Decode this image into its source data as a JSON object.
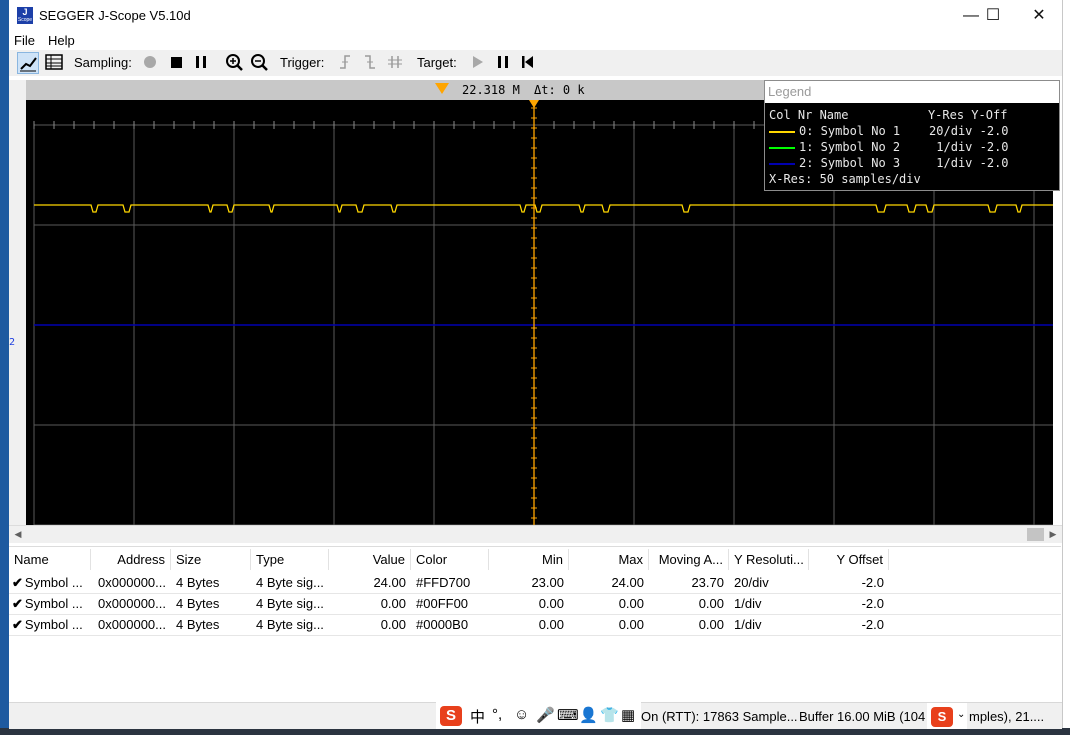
{
  "window": {
    "title": "SEGGER J-Scope V5.10d",
    "icon_letter": "J",
    "icon_sub": "Scope",
    "minimize": "—",
    "maximize": "☐",
    "close": "✕"
  },
  "menu": {
    "file": "File",
    "help": "Help"
  },
  "toolbar": {
    "sampling_label": "Sampling:",
    "trigger_label": "Trigger:",
    "target_label": "Target:"
  },
  "scope": {
    "trigger_value": "22.318 M",
    "delta_label": "Δt:",
    "delta_value": "0 k",
    "channel_marker": "2"
  },
  "legend": {
    "title": "Legend",
    "header": "Col Nr Name           Y-Res Y-Off",
    "rows": [
      {
        "text": "0: Symbol No 1    20/div -2.0",
        "color": "#FFD700"
      },
      {
        "text": "1: Symbol No 2     1/div -2.0",
        "color": "#00FF00"
      },
      {
        "text": "2: Symbol No 3     1/div -2.0",
        "color": "#0000B0"
      }
    ],
    "xres": "X-Res: 50 samples/div"
  },
  "table": {
    "columns": [
      "Name",
      "Address",
      "Size",
      "Type",
      "Value",
      "Color",
      "Min",
      "Max",
      "Moving A...",
      "Y Resoluti...",
      "Y Offset"
    ],
    "rows": [
      [
        "Symbol ...",
        "0x000000...",
        "4 Bytes",
        "4 Byte sig...",
        "24.00",
        "#FFD700",
        "23.00",
        "24.00",
        "23.70",
        "20/div",
        "-2.0"
      ],
      [
        "Symbol ...",
        "0x000000...",
        "4 Bytes",
        "4 Byte sig...",
        "0.00",
        "#00FF00",
        "0.00",
        "0.00",
        "0.00",
        "1/div",
        "-2.0"
      ],
      [
        "Symbol ...",
        "0x000000...",
        "4 Bytes",
        "4 Byte sig...",
        "0.00",
        "#0000B0",
        "0.00",
        "0.00",
        "0.00",
        "1/div",
        "-2.0"
      ]
    ]
  },
  "status": {
    "rtt": "On (RTT): 17863 Sample...",
    "buffer": "Buffer 16.00 MiB (104",
    "samples": "mples), 21...."
  },
  "colors": {
    "ch0": "#FFD700",
    "ch1": "#00FF00",
    "ch2": "#0000B0",
    "cursor": "#FFA500"
  }
}
